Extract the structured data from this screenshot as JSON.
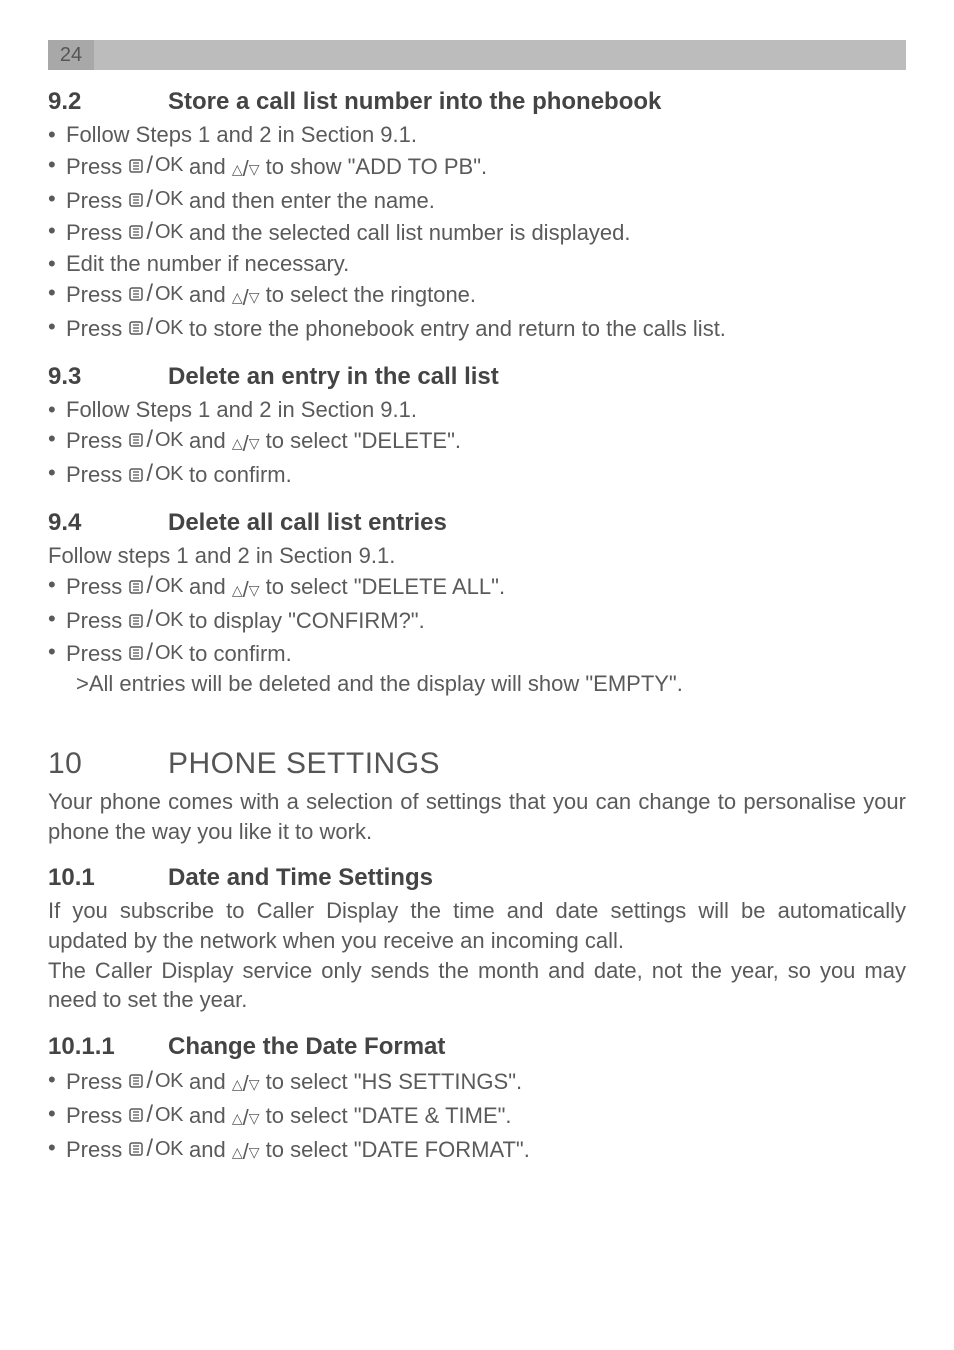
{
  "page_number": "24",
  "s92": {
    "num": "9.2",
    "title": "Store a call list number into the phonebook",
    "b1": "Follow Steps 1 and 2 in Section 9.1.",
    "b2a": "Press ",
    "b2b": " and ",
    "b2c": " to show \"ADD TO PB\".",
    "b3a": "Press ",
    "b3b": " and then enter the name.",
    "b4a": "Press ",
    "b4b": " and the selected call list number is displayed.",
    "b5": "Edit the number if necessary.",
    "b6a": "Press ",
    "b6b": " and ",
    "b6c": " to select the ringtone.",
    "b7a": "Press ",
    "b7b": " to store the phonebook entry and return to the calls list."
  },
  "s93": {
    "num": "9.3",
    "title": "Delete an entry in the call list",
    "b1": "Follow Steps 1 and 2 in Section 9.1.",
    "b2a": "Press ",
    "b2b": " and ",
    "b2c": " to select \"DELETE\".",
    "b3a": "Press ",
    "b3b": " to confirm."
  },
  "s94": {
    "num": "9.4",
    "title": "Delete all call list entries",
    "intro": "Follow steps 1 and 2 in Section 9.1.",
    "b1a": "Press ",
    "b1b": " and ",
    "b1c": " to select \"DELETE ALL\".",
    "b2a": "Press ",
    "b2b": " to display \"CONFIRM?\".",
    "b3a": "Press ",
    "b3b": " to confirm.",
    "sub": ">All entries will be deleted and the display will show \"EMPTY\"."
  },
  "ch10": {
    "num": "10",
    "title": "PHONE SETTINGS",
    "intro": "Your phone comes with a selection of settings that you can change to personalise your phone the way you like it to work."
  },
  "s101": {
    "num": "10.1",
    "title": "Date and Time Settings",
    "p1": "If you subscribe to Caller Display the time and date settings will be automatically updated by the network when you receive an incoming call.",
    "p2": "The Caller Display service only sends the month and date, not the year, so you may need to set the year."
  },
  "s1011": {
    "num": "10.1.1",
    "title": "Change the Date Format",
    "b1a": "Press ",
    "b1b": " and ",
    "b1c": " to select \"HS SETTINGS\".",
    "b2a": "Press ",
    "b2b": " and ",
    "b2c": " to select \"DATE & TIME\".",
    "b3a": "Press ",
    "b3b": " and ",
    "b3c": " to select \"DATE FORMAT\"."
  },
  "icons": {
    "ok": "OK"
  }
}
